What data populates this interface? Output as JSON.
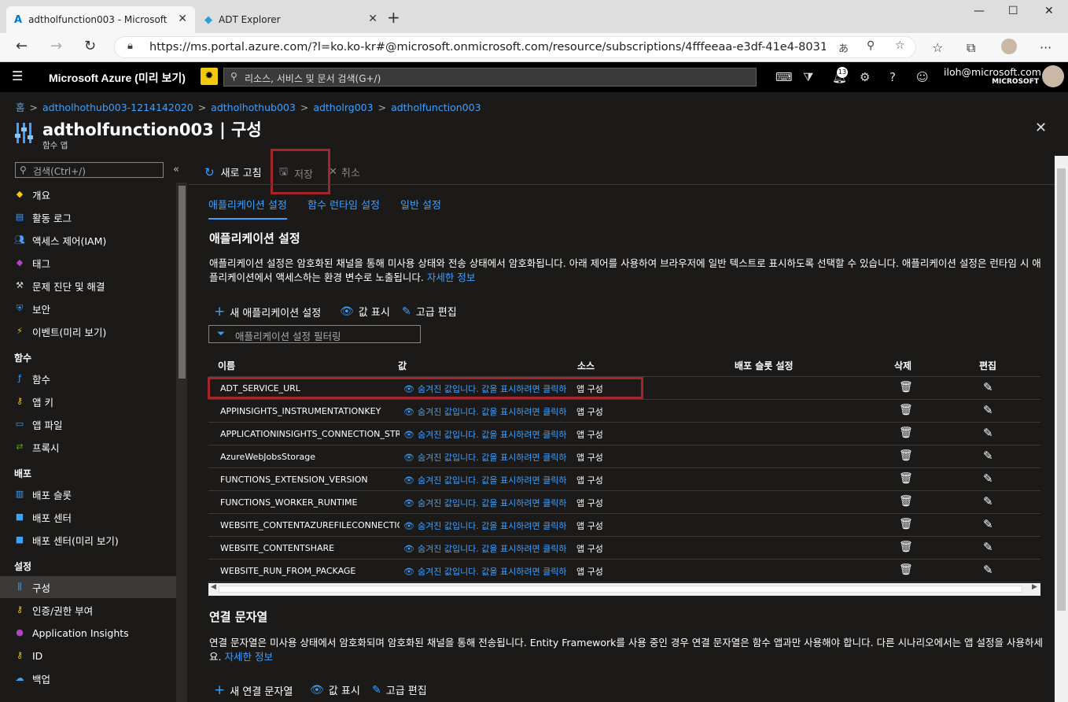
{
  "browser": {
    "tabs": [
      {
        "title": "adtholfunction003 - Microsoft Az",
        "icon": "azure-icon"
      },
      {
        "title": "ADT Explorer",
        "icon": "adt-icon"
      }
    ],
    "url": "https://ms.portal.azure.com/?l=ko.ko-kr#@microsoft.onmicrosoft.com/resource/subscriptions/4fffeeaa-e3df-41e4-8031-..."
  },
  "header": {
    "brand": "Microsoft Azure (미리 보기)",
    "search_placeholder": "리소스, 서비스 및 문서 검색(G+/)",
    "notification_count": "13",
    "user_email": "iloh@microsoft.com",
    "user_org": "MICROSOFT"
  },
  "breadcrumb": [
    "홈",
    "adtholhothub003-1214142020",
    "adtholhothub003",
    "adtholrg003",
    "adtholfunction003"
  ],
  "page": {
    "title": "adtholfunction003 | 구성",
    "subtitle": "함수 앱"
  },
  "sidebar": {
    "search_placeholder": "검색(Ctrl+/)",
    "items_top": [
      {
        "label": "개요",
        "icon": "overview-icon",
        "color": "#f2c811"
      },
      {
        "label": "활동 로그",
        "icon": "activity-log-icon",
        "color": "#3ea0ff"
      },
      {
        "label": "액세스 제어(IAM)",
        "icon": "iam-icon",
        "color": "#3ea0ff"
      },
      {
        "label": "태그",
        "icon": "tag-icon",
        "color": "#b146c2"
      },
      {
        "label": "문제 진단 및 해결",
        "icon": "wrench-icon",
        "color": "#ddd"
      },
      {
        "label": "보안",
        "icon": "shield-icon",
        "color": "#3ea0ff"
      },
      {
        "label": "이벤트(미리 보기)",
        "icon": "lightning-icon",
        "color": "#f2c811"
      }
    ],
    "section_functions": "함수",
    "items_functions": [
      {
        "label": "함수",
        "icon": "function-icon",
        "color": "#3ea0ff"
      },
      {
        "label": "앱 키",
        "icon": "key-icon",
        "color": "#f2c811"
      },
      {
        "label": "앱 파일",
        "icon": "app-files-icon",
        "color": "#3ea0ff"
      },
      {
        "label": "프록시",
        "icon": "proxy-icon",
        "color": "#57a300"
      }
    ],
    "section_deploy": "배포",
    "items_deploy": [
      {
        "label": "배포 슬롯",
        "icon": "deployment-slots-icon",
        "color": "#3ea0ff"
      },
      {
        "label": "배포 센터",
        "icon": "cube-icon",
        "color": "#3ea0ff"
      },
      {
        "label": "배포 센터(미리 보기)",
        "icon": "cube-icon",
        "color": "#3ea0ff"
      }
    ],
    "section_settings": "설정",
    "items_settings": [
      {
        "label": "구성",
        "icon": "configuration-icon",
        "color": "#3ea0ff"
      },
      {
        "label": "인증/권한 부여",
        "icon": "key-icon",
        "color": "#f2c811"
      },
      {
        "label": "Application Insights",
        "icon": "lightbulb-icon",
        "color": "#b146c2"
      },
      {
        "label": "ID",
        "icon": "identity-icon",
        "color": "#f2c811"
      },
      {
        "label": "백업",
        "icon": "backup-icon",
        "color": "#3ea0ff"
      }
    ]
  },
  "commands": {
    "refresh": "새로 고침",
    "save": "저장",
    "discard": "취소"
  },
  "tabs": [
    "애플리케이션 설정",
    "함수 런타임 설정",
    "일반 설정"
  ],
  "app_settings": {
    "heading": "애플리케이션 설정",
    "description": "애플리케이션 설정은 암호화된 채널을 통해 미사용 상태와 전송 상태에서 암호화됩니다. 아래 제어를 사용하여 브라우저에 일반 텍스트로 표시하도록 선택할 수 있습니다. 애플리케이션 설정은 런타임 시 애플리케이션에서 액세스하는 환경 변수로 노출됩니다.",
    "learn_more": "자세한 정보",
    "new_button": "새 애플리케이션 설정",
    "show_values": "값 표시",
    "advanced_edit": "고급 편집",
    "filter_placeholder": "애플리케이션 설정 필터링",
    "columns": [
      "이름",
      "값",
      "소스",
      "배포 슬롯 설정",
      "삭제",
      "편집"
    ],
    "rows": [
      {
        "name": "ADT_SERVICE_URL",
        "value": "숨겨진 값입니다. 값을 표시하려면 클릭하",
        "source": "앱 구성"
      },
      {
        "name": "APPINSIGHTS_INSTRUMENTATIONKEY",
        "value": "숨겨진 값입니다. 값을 표시하려면 클릭하",
        "source": "앱 구성"
      },
      {
        "name": "APPLICATIONINSIGHTS_CONNECTION_STRIN",
        "value": "숨겨진 값입니다. 값을 표시하려면 클릭하",
        "source": "앱 구성"
      },
      {
        "name": "AzureWebJobsStorage",
        "value": "숨겨진 값입니다. 값을 표시하려면 클릭하",
        "source": "앱 구성"
      },
      {
        "name": "FUNCTIONS_EXTENSION_VERSION",
        "value": "숨겨진 값입니다. 값을 표시하려면 클릭하",
        "source": "앱 구성"
      },
      {
        "name": "FUNCTIONS_WORKER_RUNTIME",
        "value": "숨겨진 값입니다. 값을 표시하려면 클릭하",
        "source": "앱 구성"
      },
      {
        "name": "WEBSITE_CONTENTAZUREFILECONNECTIONS",
        "value": "숨겨진 값입니다. 값을 표시하려면 클릭하",
        "source": "앱 구성"
      },
      {
        "name": "WEBSITE_CONTENTSHARE",
        "value": "숨겨진 값입니다. 값을 표시하려면 클릭하",
        "source": "앱 구성"
      },
      {
        "name": "WEBSITE_RUN_FROM_PACKAGE",
        "value": "숨겨진 값입니다. 값을 표시하려면 클릭하",
        "source": "앱 구성"
      }
    ]
  },
  "connection_strings": {
    "heading": "연결 문자열",
    "description": "연결 문자열은 미사용 상태에서 암호화되며 암호화된 채널을 통해 전송됩니다. Entity Framework를 사용 중인 경우 연결 문자열은 함수 앱과만 사용해야 합니다. 다른 시나리오에서는 앱 설정을 사용하세요.",
    "learn_more": "자세한 정보",
    "new_button": "새 연결 문자열",
    "show_values": "값 표시",
    "advanced_edit": "고급 편집"
  },
  "colors": {
    "accent": "#3ea0ff",
    "highlight_box": "#a4262c",
    "background": "#1b1a19"
  }
}
